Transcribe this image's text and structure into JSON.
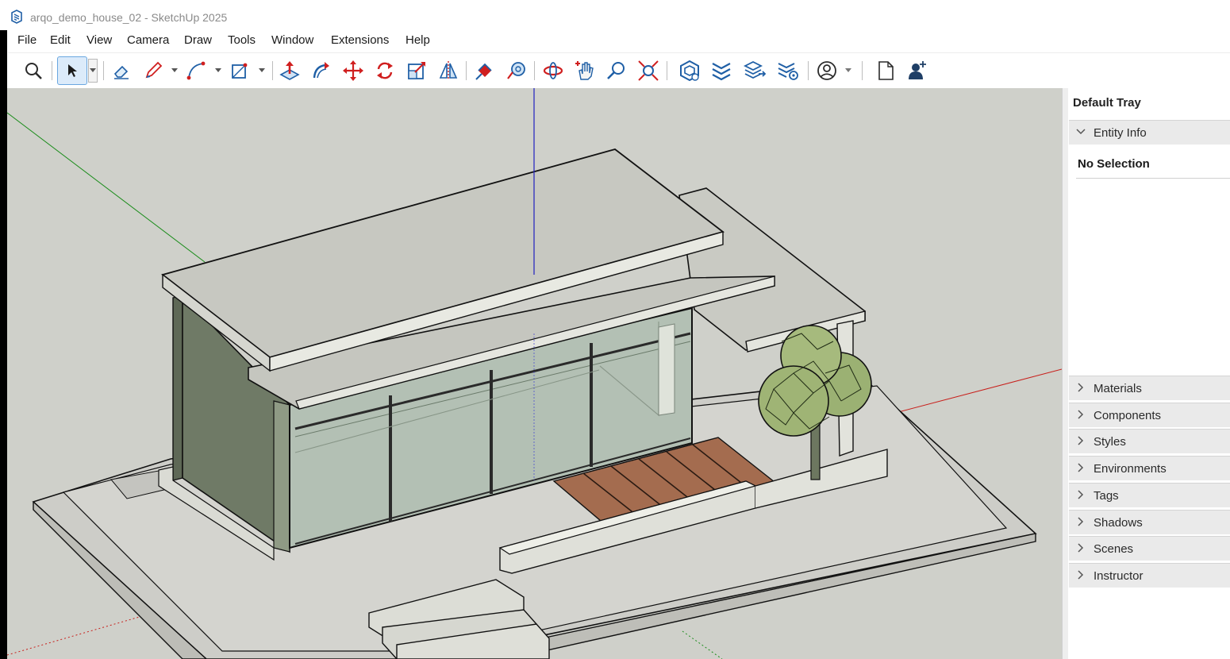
{
  "window": {
    "title": "arqo_demo_house_02 - SketchUp 2025"
  },
  "menu": [
    "File",
    "Edit",
    "View",
    "Camera",
    "Draw",
    "Tools",
    "Window",
    "Extensions",
    "Help"
  ],
  "toolbar": {
    "tools": [
      "search",
      "select",
      "eraser",
      "pencil-line",
      "arc",
      "rectangle",
      "push-pull",
      "follow-me",
      "move",
      "rotate",
      "scale",
      "flip",
      "paint",
      "tape-measure",
      "orbit",
      "pan",
      "zoom",
      "zoom-extents",
      "warehouse",
      "extension-manager",
      "layout-send",
      "styles-settings",
      "account",
      "new-file",
      "add-user"
    ]
  },
  "tray": {
    "title": "Default Tray",
    "entity_info": {
      "label": "Entity Info",
      "selection": "No Selection"
    },
    "panels": [
      "Materials",
      "Components",
      "Styles",
      "Environments",
      "Tags",
      "Shadows",
      "Scenes",
      "Instructor"
    ]
  },
  "colors": {
    "viewport_bg": "#cfd0ca",
    "slab": "#d9dad3",
    "wall": "#6f7a66",
    "glass": "#b3c0b4",
    "wood": "#a46c4f",
    "tree": "#9bb173",
    "accent": "#2c7fd3"
  }
}
